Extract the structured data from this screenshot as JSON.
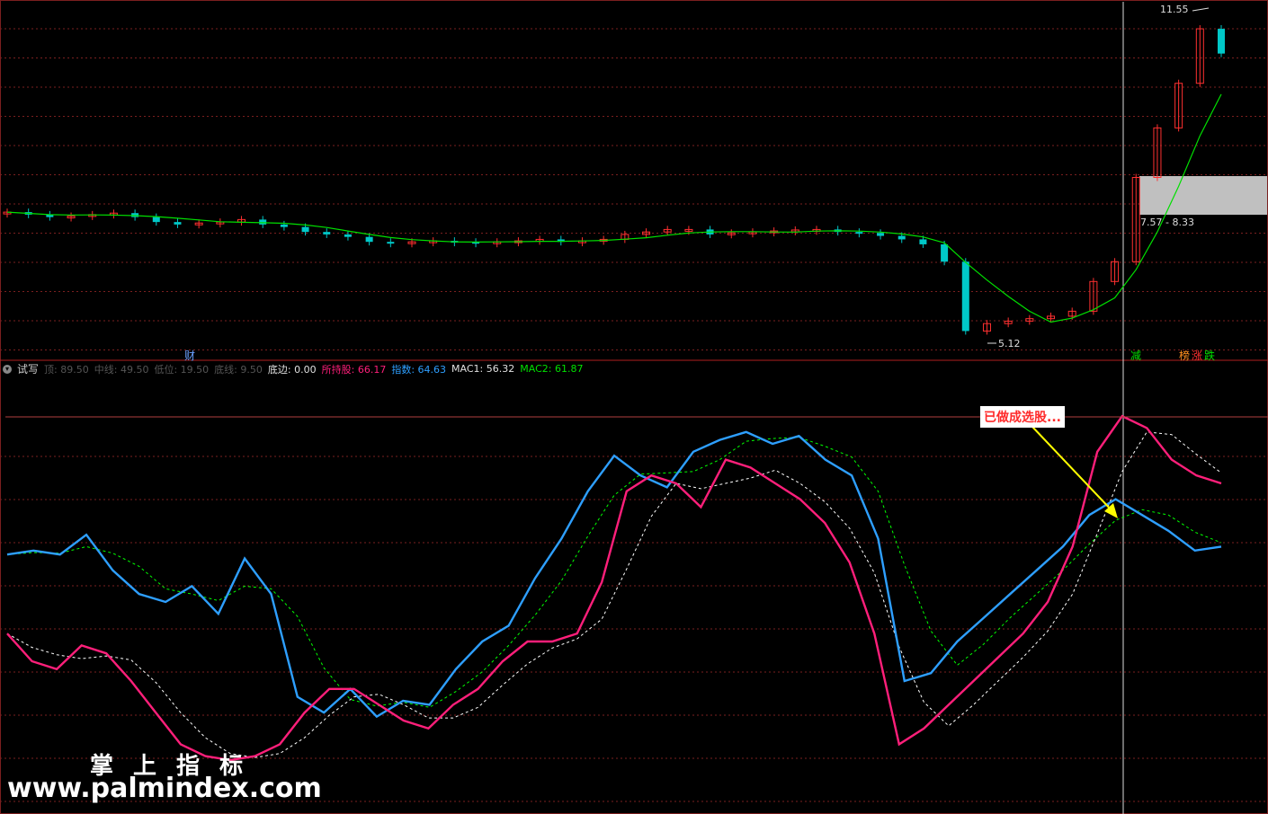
{
  "colors": {
    "background": "#000000",
    "grid_red": "#7a1f1f",
    "candle_up": "#ff3030",
    "candle_down": "#00c8c8",
    "ma_line": "#00e000",
    "blue_line": "#2e9fff",
    "magenta_line": "#ff1f7a",
    "green_dash": "#00ff00",
    "white_dash": "#ffffff",
    "note_text": "#ff2a2a",
    "arrow": "#ffff00",
    "highlight_box": "#c0c0c0"
  },
  "price_panel": {
    "high_label": "11.55",
    "low_label": "5.12",
    "range_label": "7.57 - 8.33",
    "finance_tag": "财",
    "event_tags": [
      "减",
      "榜",
      "涨",
      "跌"
    ]
  },
  "indicator_panel": {
    "name": "试写",
    "params": [
      {
        "label": "顶:",
        "value": "89.50"
      },
      {
        "label": "中线:",
        "value": "49.50"
      },
      {
        "label": "低位:",
        "value": "19.50"
      },
      {
        "label": "底线:",
        "value": "9.50"
      }
    ],
    "bottom_edge": {
      "label": "底边:",
      "value": "0.00"
    },
    "holding": {
      "label": "所持股:",
      "value": "66.17"
    },
    "index": {
      "label": "指数:",
      "value": "64.63"
    },
    "mac1": {
      "label": "MAC1:",
      "value": "56.32"
    },
    "mac2": {
      "label": "MAC2:",
      "value": "61.87"
    }
  },
  "annotation": {
    "text": "已做成选股..."
  },
  "watermark": {
    "title": "掌上指标",
    "url": "www.palmindex.com"
  },
  "chart_data": {
    "type": "line",
    "candles": {
      "description_values": "approximate close prices",
      "values": [
        7.6,
        7.55,
        7.5,
        7.52,
        7.55,
        7.58,
        7.5,
        7.4,
        7.35,
        7.38,
        7.4,
        7.45,
        7.35,
        7.3,
        7.2,
        7.15,
        7.1,
        7.0,
        6.98,
        7.0,
        7.02,
        7.0,
        6.98,
        7.0,
        7.02,
        7.05,
        7.0,
        7.02,
        7.05,
        7.15,
        7.2,
        7.25,
        7.25,
        7.15,
        7.18,
        7.2,
        7.22,
        7.24,
        7.25,
        7.2,
        7.18,
        7.12,
        7.05,
        6.95,
        6.6,
        5.2,
        5.35,
        5.4,
        5.45,
        5.5,
        5.6,
        6.2,
        6.6,
        8.3,
        9.3,
        10.2,
        11.3,
        10.8
      ]
    },
    "series": [
      {
        "name": "所持股",
        "values": [
          42,
          35,
          33,
          39,
          37,
          30,
          22,
          14,
          11,
          10,
          11,
          14,
          22,
          28,
          28,
          24,
          20,
          18,
          24,
          28,
          35,
          40,
          40,
          42,
          55,
          78,
          82,
          80,
          74,
          86,
          84,
          80,
          76,
          70,
          60,
          42,
          14,
          18,
          24,
          30,
          36,
          42,
          50,
          64,
          88,
          97,
          94,
          86,
          82,
          80
        ]
      },
      {
        "name": "指数",
        "values": [
          62,
          63,
          62,
          67,
          58,
          52,
          50,
          54,
          47,
          61,
          52,
          26,
          22,
          28,
          21,
          25,
          24,
          33,
          40,
          44,
          56,
          66,
          78,
          87,
          82,
          79,
          88,
          91,
          93,
          90,
          92,
          86,
          82,
          66,
          30,
          32,
          40,
          46,
          52,
          58,
          64,
          72,
          76,
          72,
          68,
          63,
          64
        ]
      },
      {
        "name": "MAC1",
        "values": [
          56.32
        ]
      },
      {
        "name": "MAC2",
        "values": [
          61.87
        ]
      }
    ],
    "ylim": [
      0,
      100
    ]
  }
}
